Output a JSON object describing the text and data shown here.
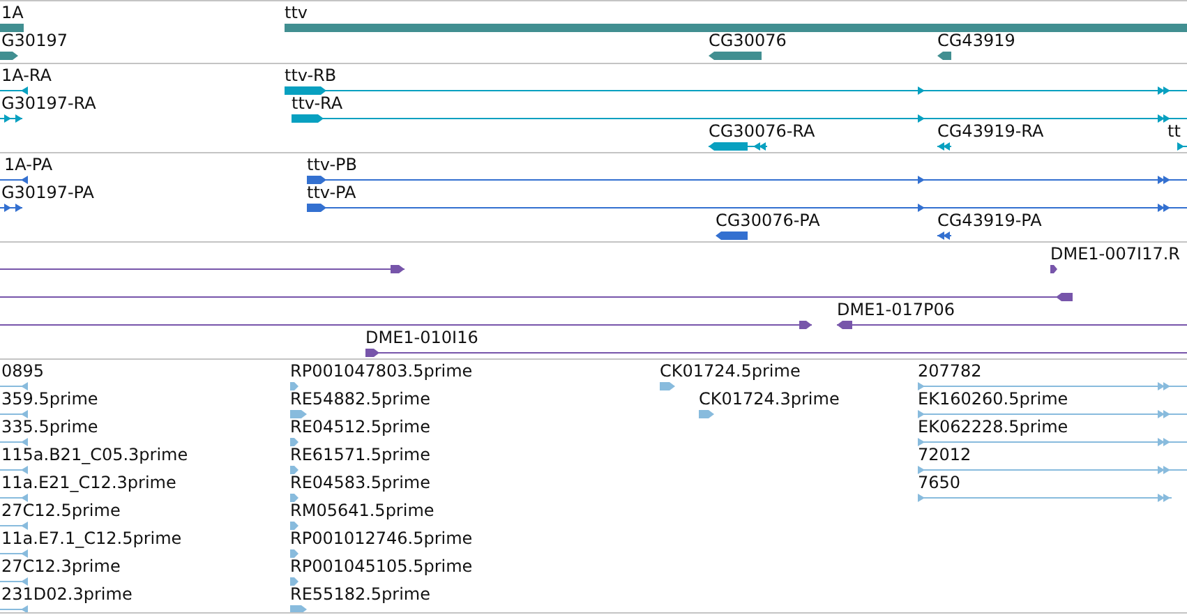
{
  "tracks": [
    {
      "kind": "gene",
      "color": "#418f91",
      "features": [
        {
          "label": "1A"
        },
        {
          "label": "G30197",
          "reverse": false
        },
        {
          "label": "ttv"
        },
        {
          "label": "CG30076",
          "reverse": true
        },
        {
          "label": "CG43919",
          "reverse": true
        }
      ]
    },
    {
      "kind": "mrna",
      "color": "#08a0c0",
      "features": [
        {
          "label": "1A-RA",
          "reverse": true
        },
        {
          "label": "G30197-RA",
          "reverse": false
        },
        {
          "label": "ttv-RB",
          "reverse": false
        },
        {
          "label": "ttv-RA",
          "reverse": false
        },
        {
          "label": "CG30076-RA",
          "reverse": true
        },
        {
          "label": "CG43919-RA",
          "reverse": true
        },
        {
          "label": "tt",
          "reverse": false
        }
      ]
    },
    {
      "kind": "protein",
      "color": "#3370d0",
      "features": [
        {
          "label": "1A-PA",
          "reverse": true
        },
        {
          "label": "G30197-PA",
          "reverse": false
        },
        {
          "label": "ttv-PB",
          "reverse": false
        },
        {
          "label": "ttv-PA",
          "reverse": false
        },
        {
          "label": "CG30076-PA",
          "reverse": true
        },
        {
          "label": "CG43919-PA",
          "reverse": true
        }
      ]
    },
    {
      "kind": "match",
      "color": "#7755aa",
      "features": [
        {
          "reverse": false
        },
        {
          "label": "DME1-007I17.R",
          "reverse": false
        },
        {
          "reverse": true
        },
        {
          "reverse": false
        },
        {
          "label": "DME1-017P06",
          "reverse": true
        },
        {
          "label": "DME1-010I16",
          "reverse": false
        }
      ]
    },
    {
      "kind": "est",
      "color": "#88bbdd",
      "features": [
        {
          "label": "0895",
          "reverse": true
        },
        {
          "label": "359.5prime",
          "reverse": true
        },
        {
          "label": "335.5prime",
          "reverse": true
        },
        {
          "label": "115a.B21_C05.3prime",
          "reverse": true
        },
        {
          "label": "11a.E21_C12.3prime",
          "reverse": true
        },
        {
          "label": "27C12.5prime",
          "reverse": true
        },
        {
          "label": "11a.E7.1_C12.5prime",
          "reverse": true
        },
        {
          "label": "27C12.3prime",
          "reverse": true
        },
        {
          "label": "231D02.3prime",
          "reverse": true
        },
        {
          "label": "RP001047803.5prime",
          "reverse": false
        },
        {
          "label": "RE54882.5prime",
          "reverse": false
        },
        {
          "label": "RE04512.5prime",
          "reverse": false
        },
        {
          "label": "RE61571.5prime",
          "reverse": false
        },
        {
          "label": "RE04583.5prime",
          "reverse": false
        },
        {
          "label": "RM05641.5prime",
          "reverse": false
        },
        {
          "label": "RP001012746.5prime",
          "reverse": false
        },
        {
          "label": "RP001045105.5prime",
          "reverse": false
        },
        {
          "label": "RE55182.5prime",
          "reverse": false
        },
        {
          "label": "CK01724.5prime",
          "reverse": false
        },
        {
          "label": "CK01724.3prime",
          "reverse": false
        },
        {
          "label": "207782",
          "reverse": false
        },
        {
          "label": "EK160260.5prime",
          "reverse": false
        },
        {
          "label": "EK062228.5prime",
          "reverse": false
        },
        {
          "label": "72012",
          "reverse": false
        },
        {
          "label": "7650",
          "reverse": false
        }
      ]
    }
  ]
}
